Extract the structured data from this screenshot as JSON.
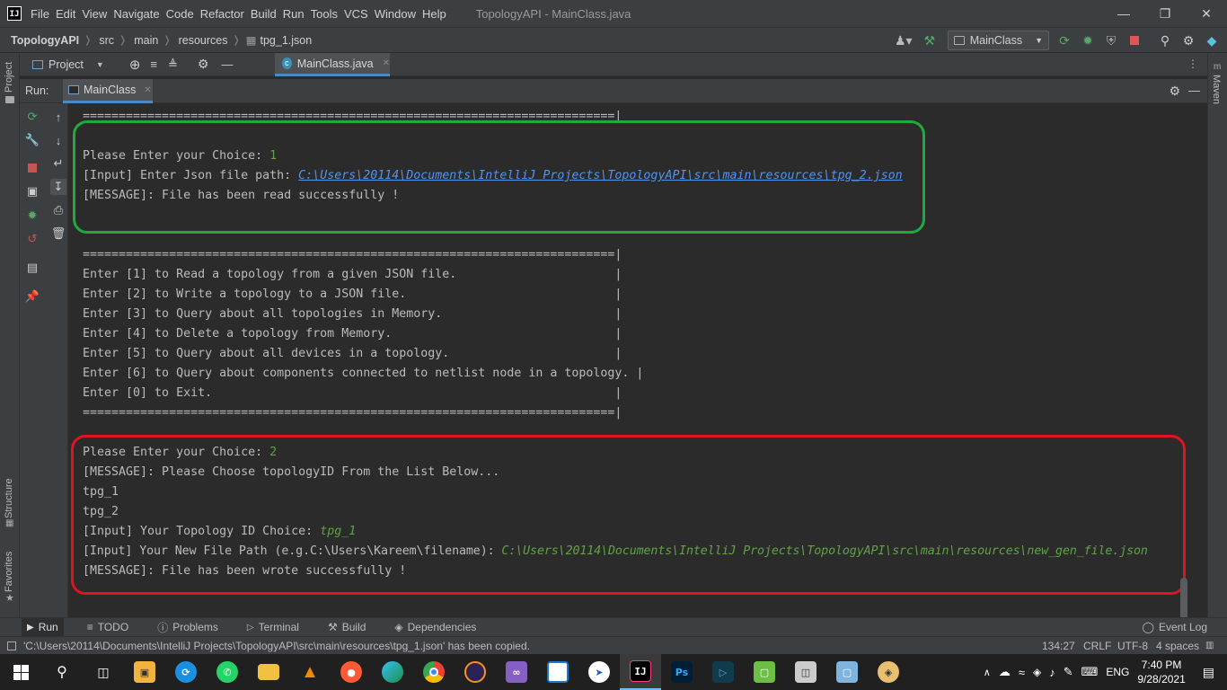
{
  "colors": {
    "accent": "#4a88c7",
    "console_input": "#5fa345",
    "console_link": "#5394ec",
    "highlight_green": "#1faa3c",
    "highlight_red": "#e0141e"
  },
  "menubar": {
    "items": [
      "File",
      "Edit",
      "View",
      "Navigate",
      "Code",
      "Refactor",
      "Build",
      "Run",
      "Tools",
      "VCS",
      "Window",
      "Help"
    ],
    "window_title": "TopologyAPI - MainClass.java"
  },
  "breadcrumb": [
    "TopologyAPI",
    "src",
    "main",
    "resources",
    "tpg_1.json"
  ],
  "run_config": "MainClass",
  "project_panel": {
    "label": "Project",
    "tab_label": "MainClass.java"
  },
  "run_panel": {
    "label": "Run:",
    "tab_label": "MainClass"
  },
  "side_labels": {
    "project": "Project",
    "structure": "Structure",
    "favorites": "Favorites",
    "maven": "Maven"
  },
  "console": {
    "sep_top": "==========================================================================|",
    "block1": {
      "choice_prompt": "Please Enter your Choice: ",
      "choice_value": "1",
      "path_prompt": "[Input] Enter Json file path: ",
      "path_value": "C:\\Users\\20114\\Documents\\IntelliJ Projects\\TopologyAPI\\src\\main\\resources\\tpg_2.json",
      "message": "[MESSAGE]: File has been read successfully !"
    },
    "menu": [
      "==========================================================================|",
      "Enter [1] to Read a topology from a given JSON file.                      |",
      "Enter [2] to Write a topology to a JSON file.                             |",
      "Enter [3] to Query about all topologies in Memory.                        |",
      "Enter [4] to Delete a topology from Memory.                               |",
      "Enter [5] to Query about all devices in a topology.                       |",
      "Enter [6] to Query about components connected to netlist node in a topology. |",
      "Enter [0] to Exit.                                                        |",
      "==========================================================================|"
    ],
    "block2": {
      "choice_prompt": "Please Enter your Choice: ",
      "choice_value": "2",
      "message1": "[MESSAGE]: Please Choose topologyID From the List Below...",
      "ids": [
        "tpg_1",
        "tpg_2"
      ],
      "id_prompt": "[Input] Your Topology ID Choice: ",
      "id_value": "tpg_1",
      "path_prompt": "[Input] Your New File Path (e.g.C:\\Users\\Kareem\\filename): ",
      "path_value": "C:\\Users\\20114\\Documents\\IntelliJ Projects\\TopologyAPI\\src\\main\\resources\\new_gen_file.json",
      "message2": "[MESSAGE]: File has been wrote successfully !"
    }
  },
  "tool_tabs": [
    "Run",
    "TODO",
    "Problems",
    "Terminal",
    "Build",
    "Dependencies"
  ],
  "event_log": "Event Log",
  "status": {
    "message": "'C:\\Users\\20114\\Documents\\IntelliJ Projects\\TopologyAPI\\src\\main\\resources\\tpg_1.json' has been copied.",
    "position": "134:27",
    "line_sep": "CRLF",
    "encoding": "UTF-8",
    "indent": "4 spaces"
  },
  "taskbar": {
    "lang": "ENG",
    "time": "7:40 PM",
    "date": "9/28/2021",
    "apps": [
      "start",
      "search",
      "task-view",
      "store",
      "sync",
      "whatsapp",
      "file-explorer",
      "vlc",
      "photo-app",
      "edge",
      "chrome",
      "eclipse",
      "visual-studio",
      "intellij-community",
      "cursor-app",
      "intellij-ultimate",
      "photoshop",
      "terminal-app",
      "image-viewer",
      "installer",
      "virtualbox",
      "paint-app"
    ]
  }
}
